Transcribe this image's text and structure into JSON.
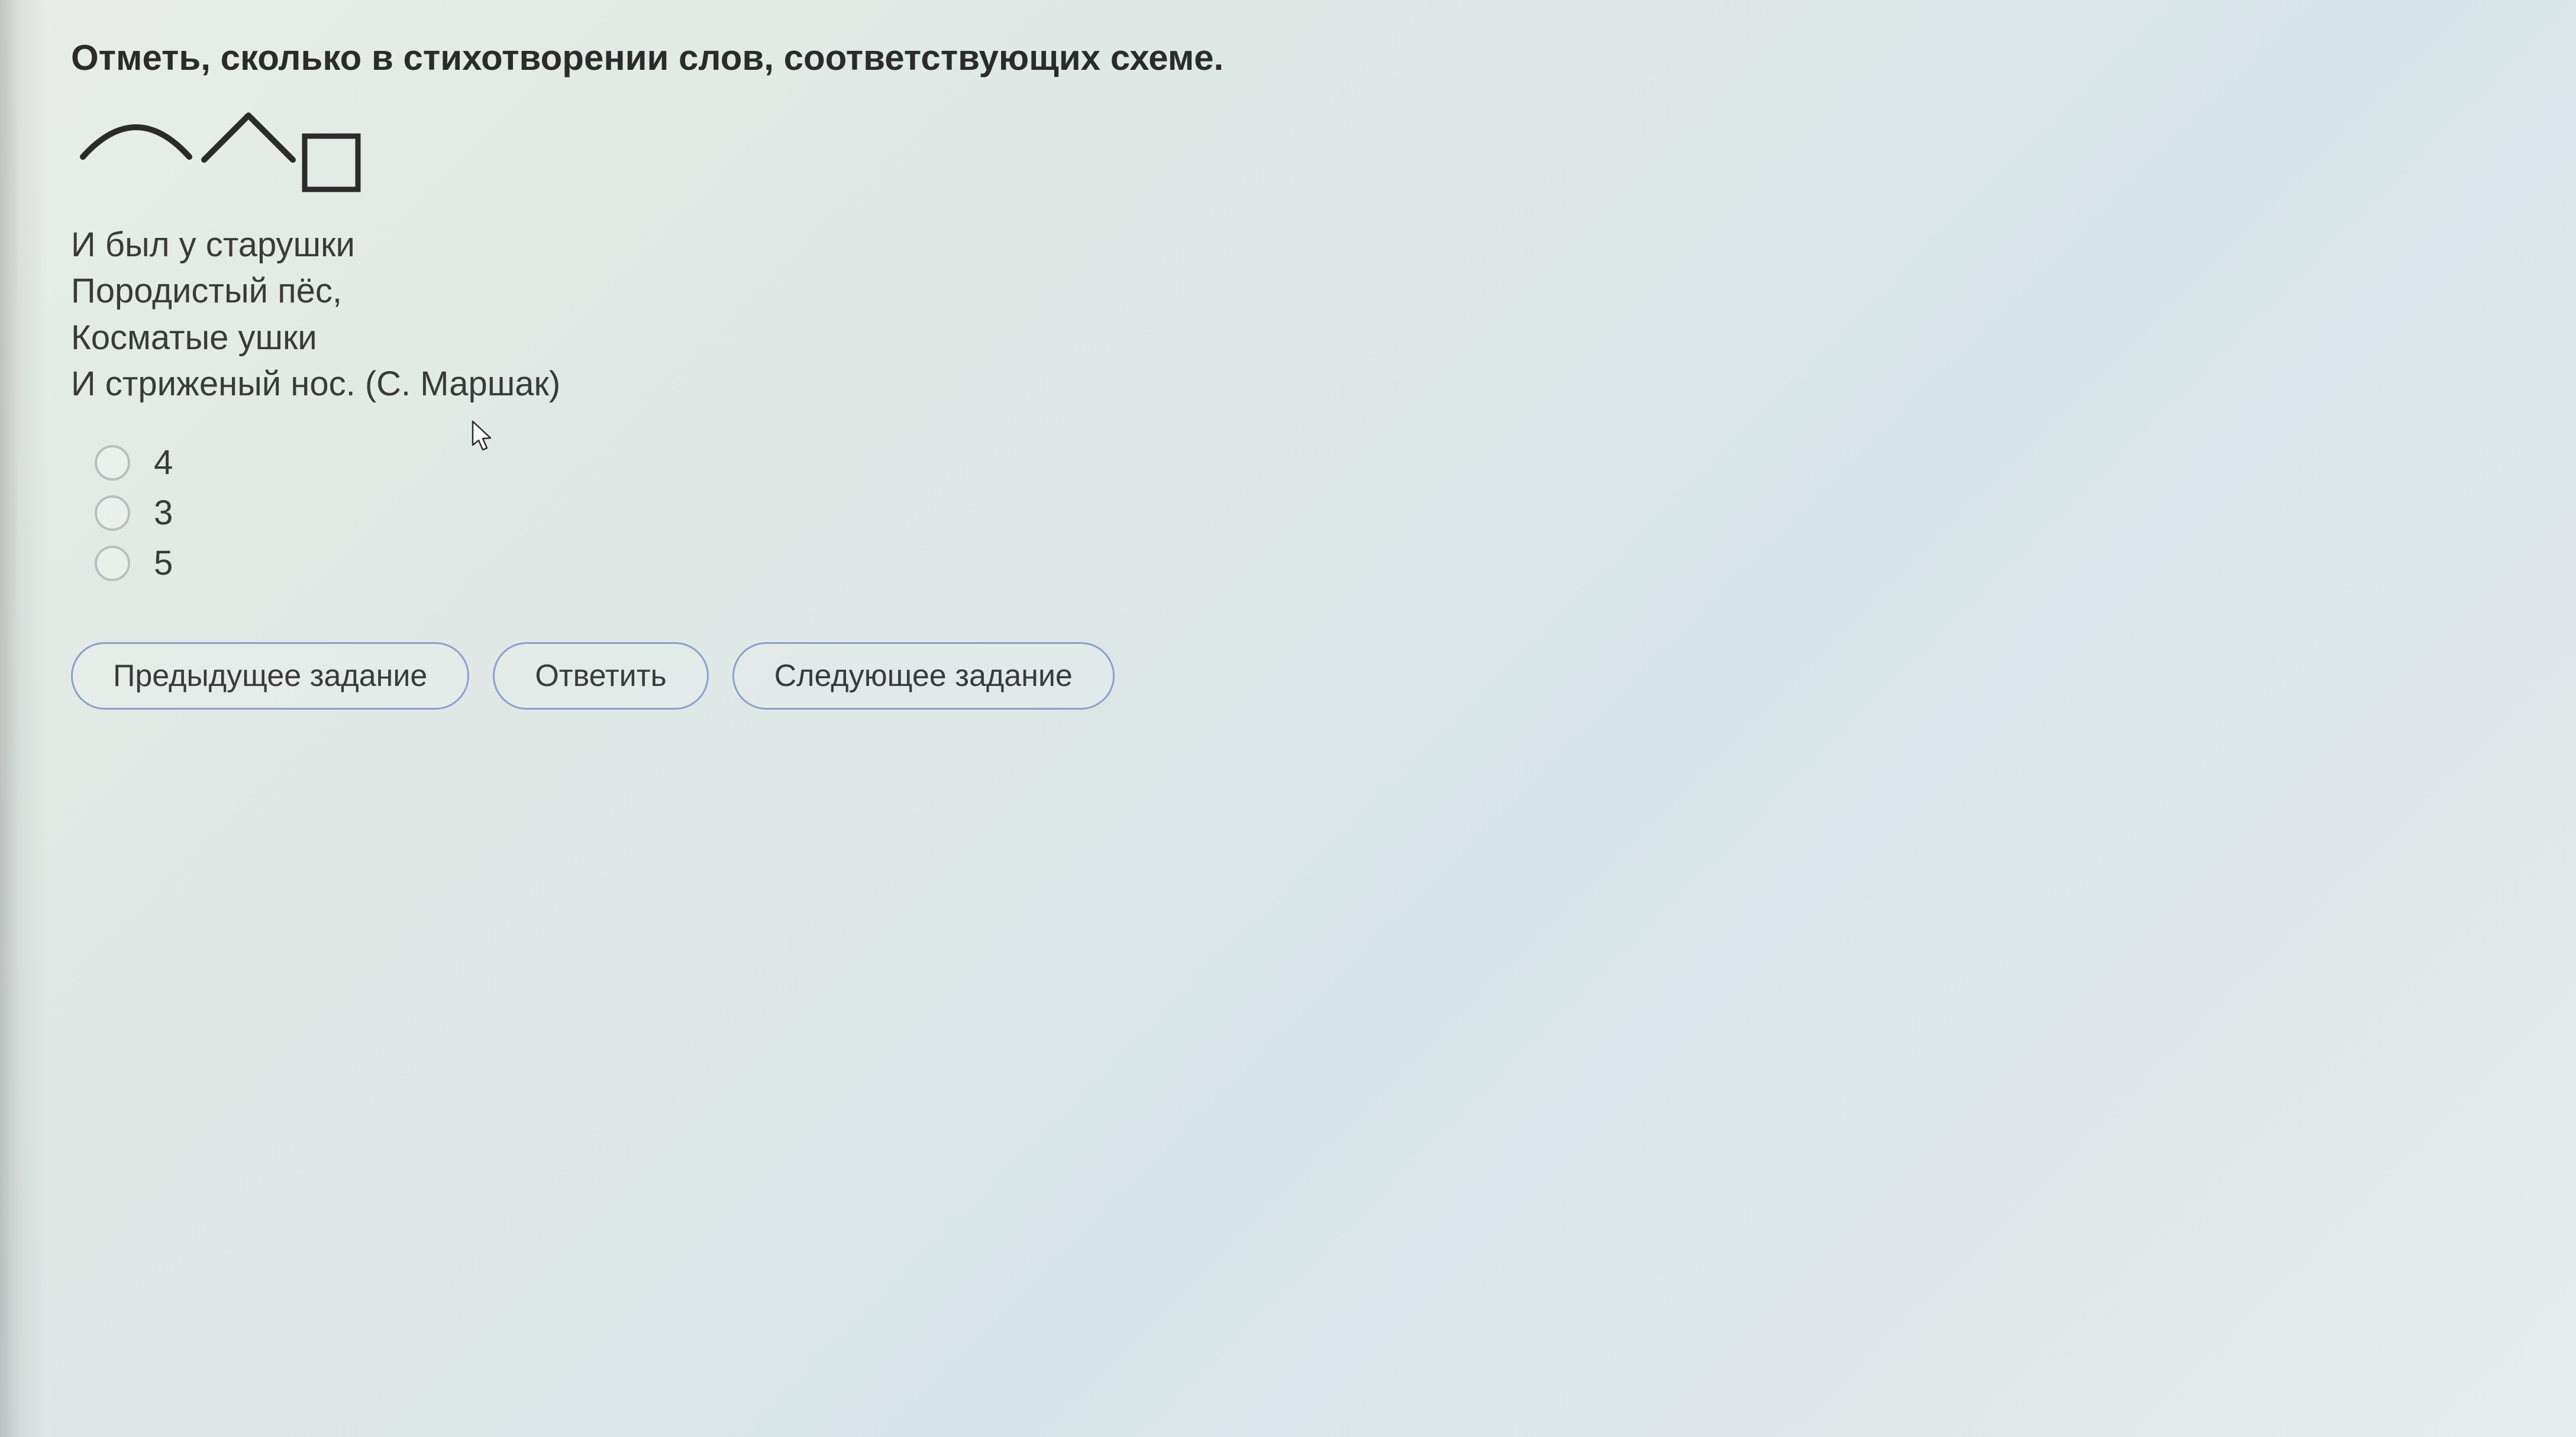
{
  "question": "Отметь, сколько в стихотворении слов, соответствующих схеме.",
  "poem": {
    "lines": [
      "И был у старушки",
      "Породистый пёс,",
      "Косматые ушки",
      "И стриженый нос."
    ],
    "author": "(С. Маршак)"
  },
  "options": [
    {
      "value": "4"
    },
    {
      "value": "3"
    },
    {
      "value": "5"
    }
  ],
  "buttons": {
    "prev": "Предыдущее задание",
    "answer": "Ответить",
    "next": "Следующее задание"
  },
  "scheme": {
    "parts": [
      "root-arc",
      "suffix-caret",
      "ending-box"
    ]
  }
}
